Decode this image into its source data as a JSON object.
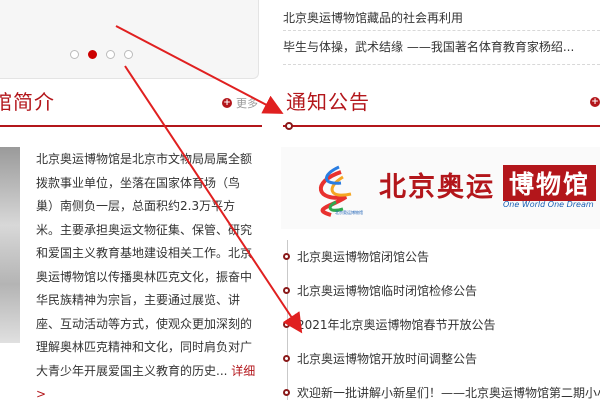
{
  "carousel": {
    "dots": 4,
    "active_index": 1
  },
  "top_news": [
    "北京奥运博物馆藏品的社会再利用",
    "毕生与体操，武术结缘 ——我国著名体育教育家杨绍..."
  ],
  "intro_section": {
    "title": "馆简介",
    "more_label": "更多"
  },
  "notice_section": {
    "title": "通知公告"
  },
  "intro_text": "北京奥运博物馆是北京市文物局局属全额拨款事业单位，坐落在国家体育场（鸟巢）南侧负一层，总面积约2.3万平方米。主要承担奥运文物征集、保管、研究和爱国主义教育基地建设相关工作。北京奥运博物馆以传播奥林匹克文化，振奋中华民族精神为宗旨，主要通过展览、讲座、互动活动等方式，使观众更加深刻的理解奥林匹克精神和文化，同时肩负对广大青少年开展爱国主义教育的历史...",
  "intro_detail_label": "详细 >",
  "logo": {
    "main": "北京奥运",
    "boxed": "博物馆",
    "slogan": "One World One Dream",
    "caption": "北京奥运博物馆"
  },
  "notices": [
    "北京奥运博物馆闭馆公告",
    "北京奥运博物馆临时闭馆检修公告",
    "2021年北京奥运博物馆春节开放公告",
    "北京奥运博物馆开放时间调整公告",
    "欢迎新一批讲解小新星们！——北京奥运博物馆第二期小小讲解员培训"
  ],
  "colors": {
    "accent": "#b3161b",
    "annotation": "#e02020"
  }
}
